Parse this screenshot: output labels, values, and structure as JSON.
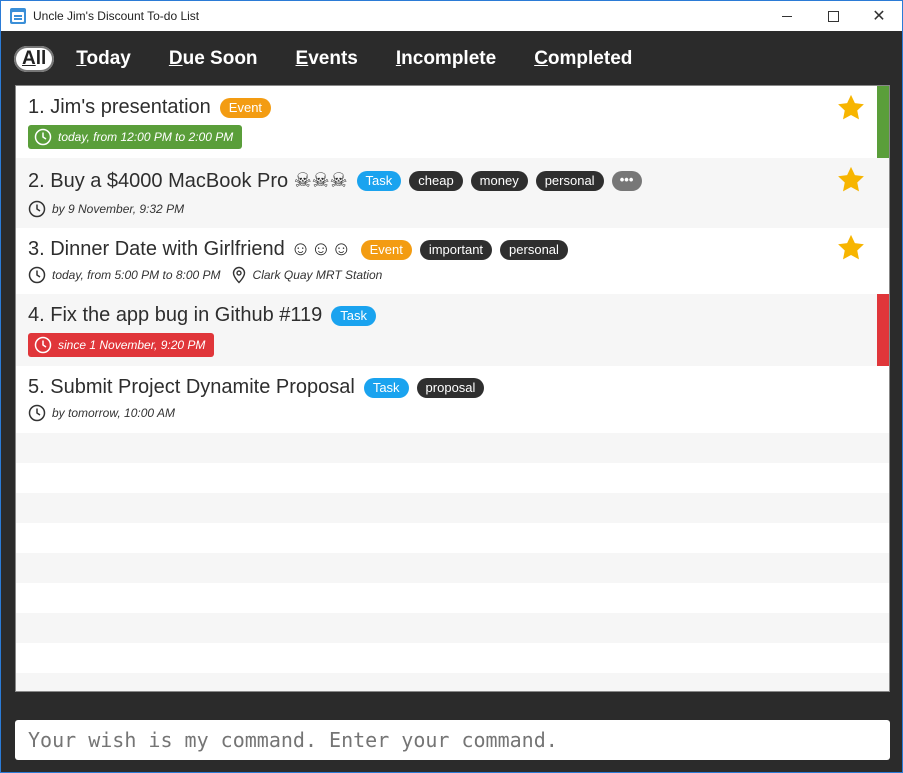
{
  "window": {
    "title": "Uncle Jim's Discount To-do List",
    "close_glyph": "✕"
  },
  "tabs": [
    {
      "underline": "A",
      "rest": "ll",
      "active": true
    },
    {
      "underline": "T",
      "rest": "oday",
      "active": false
    },
    {
      "underline": "D",
      "rest": "ue Soon",
      "active": false
    },
    {
      "underline": "E",
      "rest": "vents",
      "active": false
    },
    {
      "underline": "I",
      "rest": "ncomplete",
      "active": false
    },
    {
      "underline": "C",
      "rest": "ompleted",
      "active": false
    }
  ],
  "tasks": [
    {
      "title": "1. Jim's presentation",
      "type": "Event",
      "tags": [],
      "time": "today, from 12:00 PM to 2:00 PM",
      "time_style": "green",
      "location": "",
      "starred": true,
      "status_color": "#5a9e3a"
    },
    {
      "title": "2. Buy a $4000 MacBook Pro ☠☠☠",
      "type": "Task",
      "tags": [
        "cheap",
        "money",
        "personal"
      ],
      "more": "•••",
      "time": "by 9 November, 9:32 PM",
      "time_style": "plain",
      "location": "",
      "starred": true,
      "status_color": ""
    },
    {
      "title": "3. Dinner Date with Girlfriend ☺☺☺",
      "type": "Event",
      "tags": [
        "important",
        "personal"
      ],
      "time": "today, from 5:00 PM to 8:00 PM",
      "time_style": "plain",
      "location": "Clark Quay MRT Station",
      "starred": true,
      "status_color": ""
    },
    {
      "title": "4. Fix the app bug in Github #119",
      "type": "Task",
      "tags": [],
      "time": "since 1 November, 9:20 PM",
      "time_style": "red",
      "location": "",
      "starred": false,
      "status_color": "#e0363a"
    },
    {
      "title": "5. Submit Project Dynamite Proposal",
      "type": "Task",
      "tags": [
        "proposal"
      ],
      "time": "by tomorrow, 10:00 AM",
      "time_style": "plain",
      "location": "",
      "starred": false,
      "status_color": ""
    }
  ],
  "command": {
    "placeholder": "Your wish is my command. Enter your command."
  },
  "colors": {
    "event": "#f39c12",
    "task": "#1aa3ef",
    "tag": "#2f2f2f",
    "star": "#f7b500",
    "overdue": "#e0363a",
    "ongoing": "#5a9e3a",
    "background": "#2b2b2b"
  }
}
